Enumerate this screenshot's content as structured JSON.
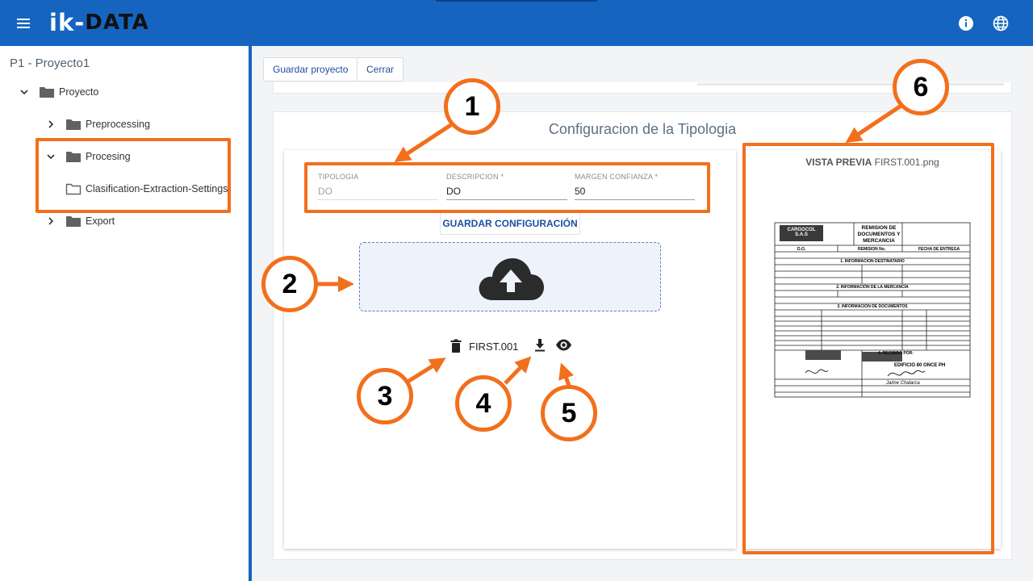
{
  "app": {
    "logo_prefix": "ik-",
    "logo_suffix": "DATA"
  },
  "sidebar": {
    "project_title": "P1 - Proyecto1",
    "tree": {
      "root": "Proyecto",
      "preprocessing": "Preprocessing",
      "procesing": "Procesing",
      "settings": "Clasification-Extraction-Settings",
      "export": "Export"
    }
  },
  "toolbar": {
    "save_project": "Guardar proyecto",
    "close": "Cerrar"
  },
  "section": {
    "title": "Configuracion de la Tipologia"
  },
  "form": {
    "tipologia": {
      "label": "TIPOLOGIA",
      "value": "DO"
    },
    "descripcion": {
      "label": "DESCRIPCION *",
      "value": "DO"
    },
    "margen": {
      "label": "MARGEN CONFIANZA *",
      "value": "50"
    },
    "save_button": "GUARDAR CONFIGURACIÓN"
  },
  "file": {
    "name": "FIRST.001"
  },
  "preview": {
    "title_bold": "VISTA PREVIA",
    "filename": "FIRST.001.png",
    "doc": {
      "company": "CARGOCOL S.A.S",
      "heading": "REMISION DE DOCUMENTOS Y MERCANCIA",
      "row_do": "D.O.",
      "row_remision": "REMISION No.",
      "row_fecha": "FECHA DE ENTREGA",
      "sec1": "1. INFORMACION DESTINATARIO",
      "sec2": "2. INFORMACIÓN DE LA MERCANCÍA",
      "sec3": "3. INFORMACION DE DOCUMENTOS",
      "sec4": "4. RECIBIDO POR:",
      "building": "EDIFICIO 80 ONCE PH",
      "signature": "Jaime Chalarca"
    }
  },
  "annotations": [
    "1",
    "2",
    "3",
    "4",
    "5",
    "6"
  ],
  "colors": {
    "appbar": "#1565c0",
    "annotation": "#f26f1c",
    "link": "#1e4f9c"
  }
}
